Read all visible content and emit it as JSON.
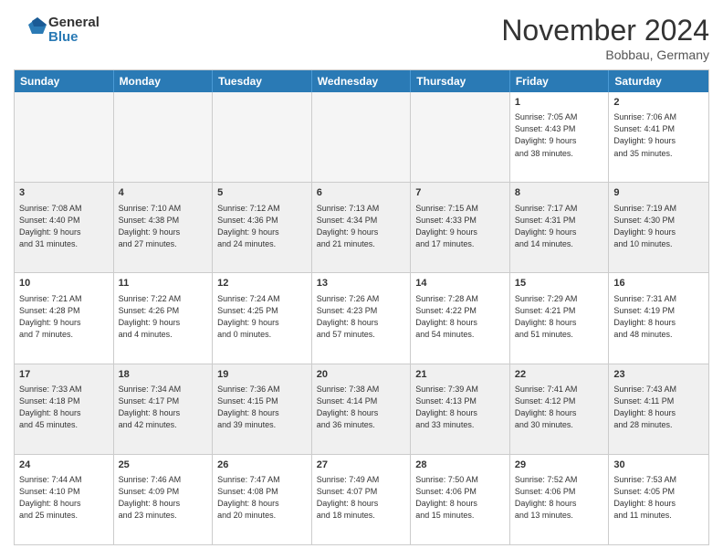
{
  "logo": {
    "line1": "General",
    "line2": "Blue"
  },
  "title": "November 2024",
  "location": "Bobbau, Germany",
  "days": [
    "Sunday",
    "Monday",
    "Tuesday",
    "Wednesday",
    "Thursday",
    "Friday",
    "Saturday"
  ],
  "weeks": [
    [
      {
        "day": "",
        "info": "",
        "empty": true
      },
      {
        "day": "",
        "info": "",
        "empty": true
      },
      {
        "day": "",
        "info": "",
        "empty": true
      },
      {
        "day": "",
        "info": "",
        "empty": true
      },
      {
        "day": "",
        "info": "",
        "empty": true
      },
      {
        "day": "1",
        "info": "Sunrise: 7:05 AM\nSunset: 4:43 PM\nDaylight: 9 hours\nand 38 minutes."
      },
      {
        "day": "2",
        "info": "Sunrise: 7:06 AM\nSunset: 4:41 PM\nDaylight: 9 hours\nand 35 minutes."
      }
    ],
    [
      {
        "day": "3",
        "info": "Sunrise: 7:08 AM\nSunset: 4:40 PM\nDaylight: 9 hours\nand 31 minutes.",
        "shaded": true
      },
      {
        "day": "4",
        "info": "Sunrise: 7:10 AM\nSunset: 4:38 PM\nDaylight: 9 hours\nand 27 minutes.",
        "shaded": true
      },
      {
        "day": "5",
        "info": "Sunrise: 7:12 AM\nSunset: 4:36 PM\nDaylight: 9 hours\nand 24 minutes.",
        "shaded": true
      },
      {
        "day": "6",
        "info": "Sunrise: 7:13 AM\nSunset: 4:34 PM\nDaylight: 9 hours\nand 21 minutes.",
        "shaded": true
      },
      {
        "day": "7",
        "info": "Sunrise: 7:15 AM\nSunset: 4:33 PM\nDaylight: 9 hours\nand 17 minutes.",
        "shaded": true
      },
      {
        "day": "8",
        "info": "Sunrise: 7:17 AM\nSunset: 4:31 PM\nDaylight: 9 hours\nand 14 minutes.",
        "shaded": true
      },
      {
        "day": "9",
        "info": "Sunrise: 7:19 AM\nSunset: 4:30 PM\nDaylight: 9 hours\nand 10 minutes.",
        "shaded": true
      }
    ],
    [
      {
        "day": "10",
        "info": "Sunrise: 7:21 AM\nSunset: 4:28 PM\nDaylight: 9 hours\nand 7 minutes."
      },
      {
        "day": "11",
        "info": "Sunrise: 7:22 AM\nSunset: 4:26 PM\nDaylight: 9 hours\nand 4 minutes."
      },
      {
        "day": "12",
        "info": "Sunrise: 7:24 AM\nSunset: 4:25 PM\nDaylight: 9 hours\nand 0 minutes."
      },
      {
        "day": "13",
        "info": "Sunrise: 7:26 AM\nSunset: 4:23 PM\nDaylight: 8 hours\nand 57 minutes."
      },
      {
        "day": "14",
        "info": "Sunrise: 7:28 AM\nSunset: 4:22 PM\nDaylight: 8 hours\nand 54 minutes."
      },
      {
        "day": "15",
        "info": "Sunrise: 7:29 AM\nSunset: 4:21 PM\nDaylight: 8 hours\nand 51 minutes."
      },
      {
        "day": "16",
        "info": "Sunrise: 7:31 AM\nSunset: 4:19 PM\nDaylight: 8 hours\nand 48 minutes."
      }
    ],
    [
      {
        "day": "17",
        "info": "Sunrise: 7:33 AM\nSunset: 4:18 PM\nDaylight: 8 hours\nand 45 minutes.",
        "shaded": true
      },
      {
        "day": "18",
        "info": "Sunrise: 7:34 AM\nSunset: 4:17 PM\nDaylight: 8 hours\nand 42 minutes.",
        "shaded": true
      },
      {
        "day": "19",
        "info": "Sunrise: 7:36 AM\nSunset: 4:15 PM\nDaylight: 8 hours\nand 39 minutes.",
        "shaded": true
      },
      {
        "day": "20",
        "info": "Sunrise: 7:38 AM\nSunset: 4:14 PM\nDaylight: 8 hours\nand 36 minutes.",
        "shaded": true
      },
      {
        "day": "21",
        "info": "Sunrise: 7:39 AM\nSunset: 4:13 PM\nDaylight: 8 hours\nand 33 minutes.",
        "shaded": true
      },
      {
        "day": "22",
        "info": "Sunrise: 7:41 AM\nSunset: 4:12 PM\nDaylight: 8 hours\nand 30 minutes.",
        "shaded": true
      },
      {
        "day": "23",
        "info": "Sunrise: 7:43 AM\nSunset: 4:11 PM\nDaylight: 8 hours\nand 28 minutes.",
        "shaded": true
      }
    ],
    [
      {
        "day": "24",
        "info": "Sunrise: 7:44 AM\nSunset: 4:10 PM\nDaylight: 8 hours\nand 25 minutes."
      },
      {
        "day": "25",
        "info": "Sunrise: 7:46 AM\nSunset: 4:09 PM\nDaylight: 8 hours\nand 23 minutes."
      },
      {
        "day": "26",
        "info": "Sunrise: 7:47 AM\nSunset: 4:08 PM\nDaylight: 8 hours\nand 20 minutes."
      },
      {
        "day": "27",
        "info": "Sunrise: 7:49 AM\nSunset: 4:07 PM\nDaylight: 8 hours\nand 18 minutes."
      },
      {
        "day": "28",
        "info": "Sunrise: 7:50 AM\nSunset: 4:06 PM\nDaylight: 8 hours\nand 15 minutes."
      },
      {
        "day": "29",
        "info": "Sunrise: 7:52 AM\nSunset: 4:06 PM\nDaylight: 8 hours\nand 13 minutes."
      },
      {
        "day": "30",
        "info": "Sunrise: 7:53 AM\nSunset: 4:05 PM\nDaylight: 8 hours\nand 11 minutes."
      }
    ]
  ]
}
